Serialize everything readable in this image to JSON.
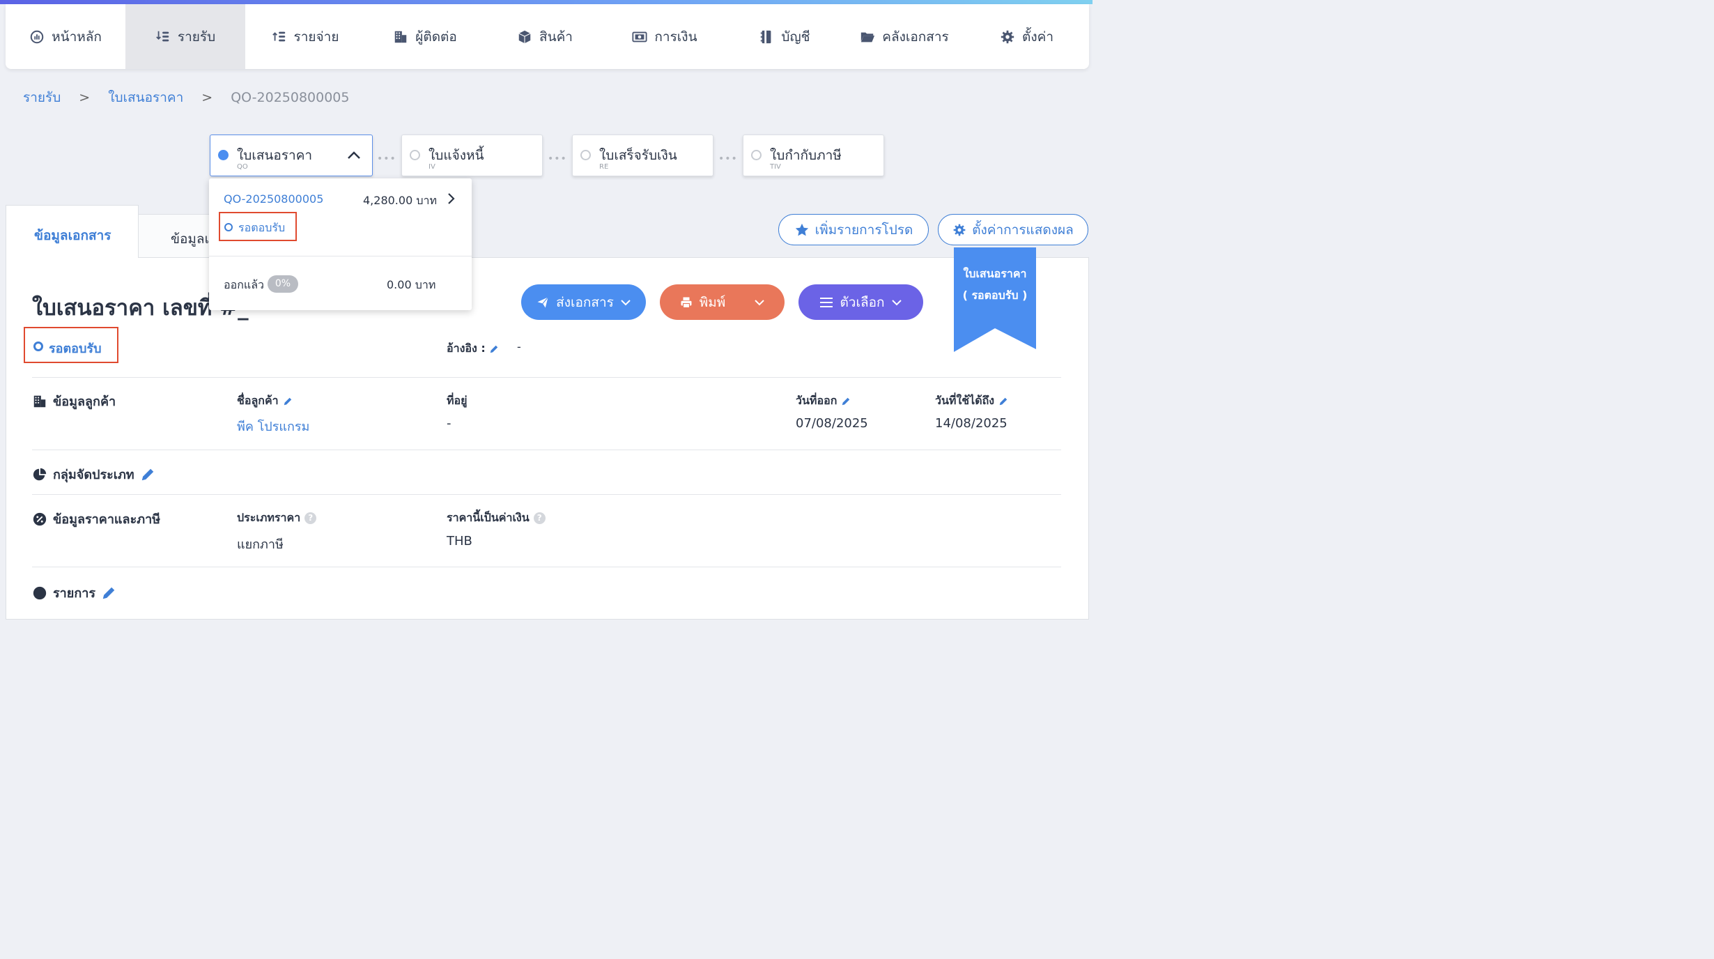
{
  "nav": {
    "items": [
      {
        "label": "หน้าหลัก",
        "icon": "dashboard-icon",
        "active": false
      },
      {
        "label": "รายรับ",
        "icon": "income-icon",
        "active": true
      },
      {
        "label": "รายจ่าย",
        "icon": "expense-icon",
        "active": false
      },
      {
        "label": "ผู้ติดต่อ",
        "icon": "building-icon",
        "active": false
      },
      {
        "label": "สินค้า",
        "icon": "box-icon",
        "active": false
      },
      {
        "label": "การเงิน",
        "icon": "money-icon",
        "active": false
      },
      {
        "label": "บัญชี",
        "icon": "ledger-icon",
        "active": false
      },
      {
        "label": "คลังเอกสาร",
        "icon": "folder-icon",
        "active": false
      },
      {
        "label": "ตั้งค่า",
        "icon": "gear-icon",
        "active": false
      }
    ]
  },
  "breadcrumb": {
    "items": [
      "รายรับ",
      "ใบเสนอราคา",
      "QO-20250800005"
    ],
    "separator": ">"
  },
  "steps": [
    {
      "title": "ใบเสนอราคา",
      "code": "QO",
      "active": true
    },
    {
      "title": "ใบแจ้งหนี้",
      "code": "IV",
      "active": false
    },
    {
      "title": "ใบเสร็จรับเงิน",
      "code": "RE",
      "active": false
    },
    {
      "title": "ใบกำกับภาษี",
      "code": "TIV",
      "active": false
    }
  ],
  "dropdown": {
    "doc_code": "QO-20250800005",
    "amount": "4,280.00 บาท",
    "status": "รอตอบรับ",
    "issued_label": "ออกแล้ว",
    "issued_percent": "0%",
    "issued_amount": "0.00 บาท"
  },
  "tabs": {
    "doc_info": "ข้อมูลเอกสาร",
    "other": "ข้อมูลเ"
  },
  "toolbar": {
    "favorite": "เพิ่มรายการโปรด",
    "display_settings": "ตั้งค่าการแสดงผล",
    "send": "ส่งเอกสาร",
    "print": "พิมพ์",
    "options": "ตัวเลือก"
  },
  "ribbon": {
    "line1": "ใบเสนอราคา",
    "line2": "( รอตอบรับ )"
  },
  "doc": {
    "title": "ใบเสนอราคา เลขที่ #_",
    "status": "รอตอบรับ",
    "ref_label": "อ้างอิง :",
    "ref_value": "-"
  },
  "customer": {
    "section": "ข้อมูลลูกค้า",
    "name_label": "ชื่อลูกค้า",
    "name": "พีค โปรแกรม",
    "address_label": "ที่อยู่",
    "address": "-",
    "issue_label": "วันที่ออก",
    "issue_date": "07/08/2025",
    "valid_label": "วันที่ใช้ได้ถึง",
    "valid_date": "14/08/2025"
  },
  "category": {
    "section": "กลุ่มจัดประเภท"
  },
  "pricing": {
    "section": "ข้อมูลราคาและภาษี",
    "type_label": "ประเภทราคา",
    "type_value": "แยกภาษี",
    "currency_label": "ราคานี้เป็นค่าเงิน",
    "currency_value": "THB"
  },
  "items": {
    "section": "รายการ"
  },
  "colors": {
    "accent": "#3f7fd6",
    "send": "#4b8ef0",
    "print": "#e9775a",
    "options": "#6b63e6",
    "highlight": "#e04a2f"
  }
}
